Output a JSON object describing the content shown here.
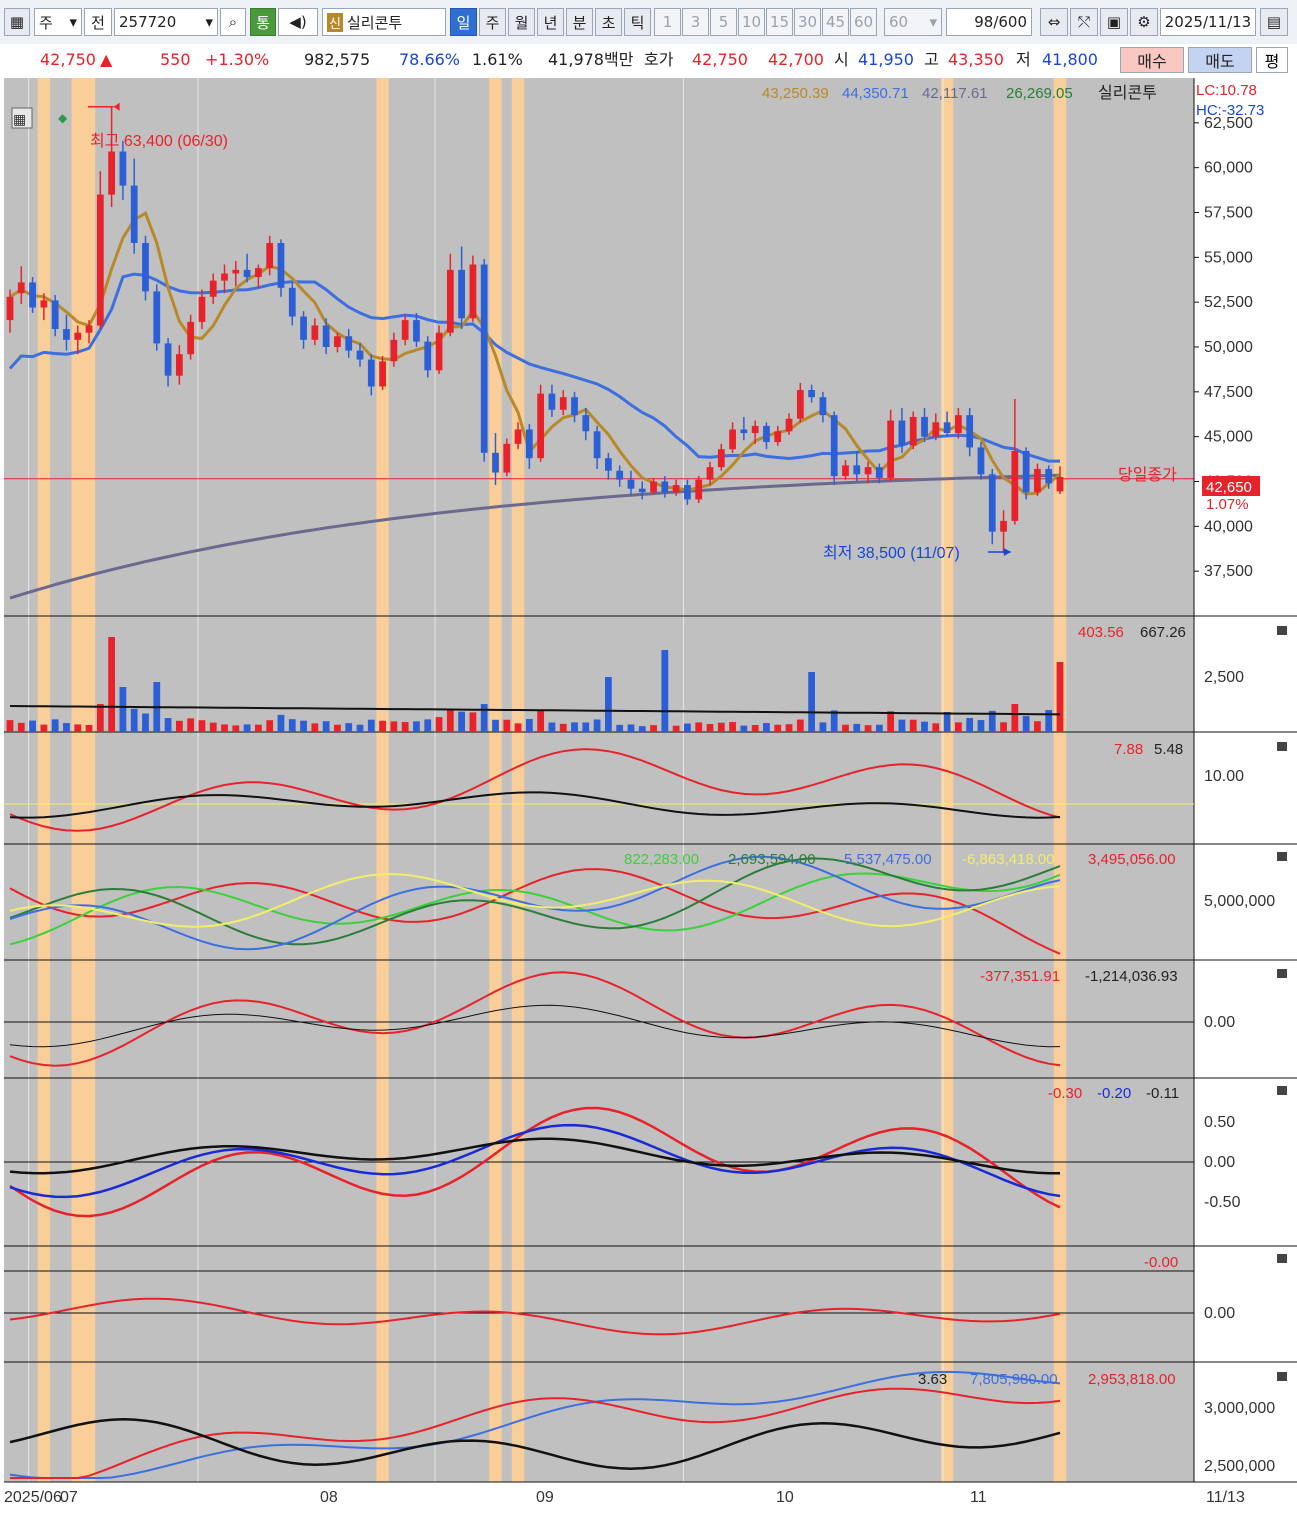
{
  "toolbar": {
    "market": "주",
    "prev": "전",
    "code": "257720",
    "tong": "통",
    "sin": "신",
    "name": "실리콘투",
    "periods": [
      "일",
      "주",
      "월",
      "년",
      "분",
      "초",
      "틱"
    ],
    "intervals": [
      "1",
      "3",
      "5",
      "10",
      "15",
      "30",
      "45",
      "60"
    ],
    "interval_input": "60",
    "count": "98",
    "count_max": "/600",
    "date": "2025/11/13"
  },
  "quote": {
    "price": "42,750",
    "arrow": "▲",
    "change": "550",
    "change_pct": "+1.30%",
    "volume": "982,575",
    "vol_ratio": "78.66%",
    "turnover": "1.61%",
    "amount": "41,978백만",
    "hoga_label": "호가",
    "ask": "42,750",
    "bid": "42,700",
    "open_label": "시",
    "open": "41,950",
    "high_label": "고",
    "high": "43,350",
    "low_label": "저",
    "low": "41,800",
    "buy": "매수",
    "sell": "매도",
    "eval": "평"
  },
  "colors": {
    "up": "#e8222b",
    "down": "#2c5fd6",
    "ma5": "#b8892a",
    "ma20": "#3d6fe0",
    "ma120": "#6b6a8e",
    "highlight": "#ffcf93",
    "bg": "#c0c0c0"
  },
  "price_panel": {
    "legend": [
      "43,250.39",
      "44,350.71",
      "42,117.61",
      "26,269.05"
    ],
    "name": "실리콘투",
    "lc": "LC:10.78",
    "hc": "HC:-32.73",
    "high_label": "최고 63,400 (06/30)",
    "low_label": "최저 38,500 (11/07)",
    "close_label": "당일종가",
    "close_value": "42,650",
    "close_pct": "1.07%",
    "close_level": 42650,
    "ticks": [
      "62,500",
      "60,000",
      "57,500",
      "55,000",
      "52,500",
      "50,000",
      "47,500",
      "45,000",
      "42,500",
      "40,000",
      "37,500"
    ]
  },
  "volume_panel": {
    "legend": [
      "403.56",
      "667.26"
    ],
    "ticks": [
      "2,500"
    ]
  },
  "panel3": {
    "legend": [
      "7.88",
      "5.48"
    ],
    "ticks": [
      "10.00"
    ]
  },
  "panel4": {
    "legend": [
      "822,283.00",
      "2,693,594.00",
      "5,537,475.00",
      "-6,863,418.00",
      "3,495,056.00"
    ],
    "ticks": [
      "5,000,000"
    ]
  },
  "panel5": {
    "legend": [
      "-377,351.91",
      "-1,214,036.93"
    ],
    "ticks": [
      "0.00"
    ]
  },
  "panel6": {
    "legend": [
      "-0.30",
      "-0.20",
      "-0.11"
    ],
    "ticks": [
      "0.50",
      "0.00",
      "-0.50"
    ]
  },
  "panel7": {
    "legend": [
      "-0.00"
    ],
    "ticks": [
      "0.00"
    ]
  },
  "panel8": {
    "legend": [
      "3.63",
      "7,805,980.00",
      "2,953,818.00"
    ],
    "ticks": [
      "3,000,000",
      "2,500,000"
    ]
  },
  "xaxis": {
    "labels": [
      "2025/06",
      "07",
      "08",
      "09",
      "10",
      "11"
    ],
    "right_label": "11/13"
  },
  "chart_data": {
    "type": "candlestick",
    "ylim": [
      35000,
      65000
    ],
    "candles": [
      [
        51500,
        53200,
        50800,
        52800
      ],
      [
        53000,
        54500,
        52400,
        53600
      ],
      [
        53600,
        53900,
        51900,
        52200
      ],
      [
        52200,
        53000,
        51500,
        52600
      ],
      [
        52600,
        52900,
        50600,
        51000
      ],
      [
        51000,
        51800,
        49800,
        50400
      ],
      [
        50400,
        51200,
        49600,
        50800
      ],
      [
        50800,
        51500,
        50200,
        51200
      ],
      [
        51200,
        59800,
        51000,
        58500
      ],
      [
        58500,
        63400,
        57800,
        60900
      ],
      [
        60900,
        61500,
        58200,
        59000
      ],
      [
        59000,
        60500,
        55200,
        55800
      ],
      [
        55800,
        56200,
        52600,
        53100
      ],
      [
        53100,
        53500,
        49800,
        50200
      ],
      [
        50200,
        50500,
        47800,
        48400
      ],
      [
        48400,
        50100,
        47900,
        49600
      ],
      [
        49600,
        51800,
        49300,
        51400
      ],
      [
        51400,
        53200,
        51000,
        52800
      ],
      [
        52800,
        54100,
        52400,
        53700
      ],
      [
        53700,
        54600,
        53000,
        54100
      ],
      [
        54100,
        54800,
        53400,
        54300
      ],
      [
        54300,
        55200,
        53600,
        53900
      ],
      [
        53900,
        54600,
        53300,
        54400
      ],
      [
        54400,
        56200,
        54000,
        55800
      ],
      [
        55800,
        56000,
        52800,
        53300
      ],
      [
        53300,
        53600,
        51200,
        51700
      ],
      [
        51700,
        52000,
        49900,
        50400
      ],
      [
        50400,
        51600,
        50100,
        51200
      ],
      [
        51200,
        51600,
        49600,
        50000
      ],
      [
        50000,
        50800,
        49700,
        50600
      ],
      [
        50600,
        51000,
        49400,
        49800
      ],
      [
        49800,
        50200,
        48900,
        49300
      ],
      [
        49300,
        49600,
        47300,
        47800
      ],
      [
        47800,
        49500,
        47600,
        49200
      ],
      [
        49200,
        50800,
        48900,
        50400
      ],
      [
        50400,
        51800,
        50100,
        51500
      ],
      [
        51500,
        51900,
        50000,
        50300
      ],
      [
        50300,
        50600,
        48300,
        48700
      ],
      [
        48700,
        51200,
        48500,
        50800
      ],
      [
        50800,
        55200,
        50600,
        54300
      ],
      [
        54300,
        55600,
        51000,
        51600
      ],
      [
        51600,
        55100,
        51400,
        54600
      ],
      [
        54600,
        54900,
        43600,
        44100
      ],
      [
        44100,
        45200,
        42300,
        43000
      ],
      [
        43000,
        44900,
        42800,
        44600
      ],
      [
        44600,
        45800,
        44300,
        45400
      ],
      [
        45400,
        45700,
        43200,
        43800
      ],
      [
        43800,
        47900,
        43600,
        47400
      ],
      [
        47400,
        47900,
        46100,
        46500
      ],
      [
        46500,
        47600,
        46200,
        47200
      ],
      [
        47200,
        47500,
        45800,
        46200
      ],
      [
        46200,
        46600,
        44800,
        45300
      ],
      [
        45300,
        45600,
        43200,
        43800
      ],
      [
        43800,
        44100,
        42600,
        43100
      ],
      [
        43100,
        43400,
        42200,
        42600
      ],
      [
        42600,
        43100,
        41700,
        42100
      ],
      [
        42100,
        42500,
        41500,
        41900
      ],
      [
        41900,
        42700,
        41800,
        42500
      ],
      [
        42500,
        42800,
        41600,
        41900
      ],
      [
        41900,
        42600,
        41700,
        42300
      ],
      [
        42300,
        42600,
        41200,
        41500
      ],
      [
        41500,
        42800,
        41300,
        42600
      ],
      [
        42600,
        43600,
        42300,
        43300
      ],
      [
        43300,
        44600,
        43100,
        44300
      ],
      [
        44300,
        45800,
        44100,
        45400
      ],
      [
        45400,
        46100,
        44800,
        45200
      ],
      [
        45200,
        45900,
        44600,
        45600
      ],
      [
        45600,
        45800,
        44300,
        44700
      ],
      [
        44700,
        45600,
        44500,
        45300
      ],
      [
        45300,
        46300,
        45100,
        46000
      ],
      [
        46000,
        48000,
        45800,
        47600
      ],
      [
        47600,
        47900,
        46900,
        47200
      ],
      [
        47200,
        47500,
        45800,
        46200
      ],
      [
        46200,
        46400,
        42300,
        42800
      ],
      [
        42800,
        43700,
        42600,
        43400
      ],
      [
        43400,
        44200,
        42500,
        42900
      ],
      [
        42900,
        43600,
        42400,
        43300
      ],
      [
        43300,
        43500,
        42400,
        42700
      ],
      [
        42700,
        46500,
        42500,
        45900
      ],
      [
        45900,
        46600,
        44100,
        44500
      ],
      [
        44500,
        46400,
        44300,
        46100
      ],
      [
        46100,
        46600,
        44700,
        45000
      ],
      [
        45000,
        46300,
        44800,
        45800
      ],
      [
        45800,
        46400,
        45000,
        45200
      ],
      [
        45200,
        46600,
        44900,
        46200
      ],
      [
        46200,
        46600,
        43900,
        44400
      ],
      [
        44400,
        44700,
        42600,
        42900
      ],
      [
        42900,
        43200,
        39000,
        39700
      ],
      [
        39700,
        40900,
        38500,
        40300
      ],
      [
        40300,
        47100,
        40100,
        44200
      ],
      [
        44200,
        44400,
        41500,
        41900
      ],
      [
        41900,
        43500,
        41700,
        43200
      ],
      [
        43200,
        43400,
        42100,
        42400
      ],
      [
        41950,
        43350,
        41800,
        42750
      ]
    ],
    "highlight_indices": [
      3,
      6,
      7,
      33,
      43,
      45,
      83,
      93
    ]
  }
}
